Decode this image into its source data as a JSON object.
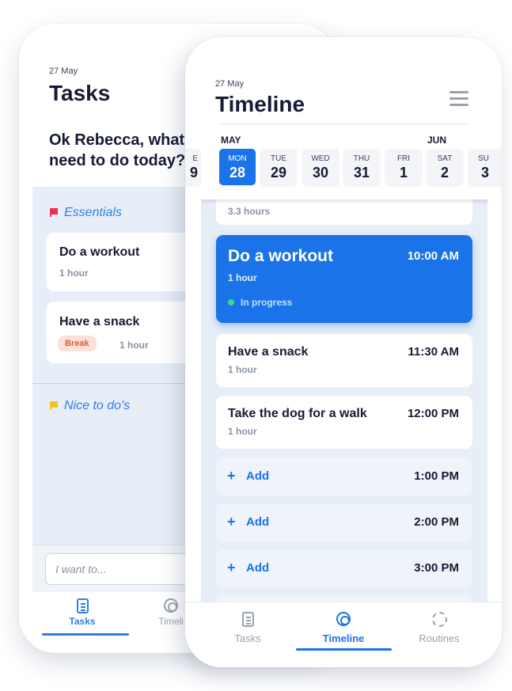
{
  "tasks_screen": {
    "date": "27 May",
    "title": "Tasks",
    "question": "Ok Rebecca, what do you\nneed to do today?",
    "question_visible_line1": "Ok Rebecca, what",
    "question_visible_line2": "need to do today?",
    "sections": [
      {
        "label": "Essentials",
        "flag_color": "#ee2d52",
        "items": [
          {
            "title": "Do a workout",
            "duration": "1 hour"
          },
          {
            "title": "Have a snack",
            "badge": "Break",
            "duration": "1 hour"
          }
        ]
      },
      {
        "label": "Nice to do's",
        "flag_color": "#f4c21c",
        "items": []
      }
    ],
    "input_placeholder": "I want to...",
    "tabs": [
      {
        "label": "Tasks",
        "icon": "tasks-icon",
        "active": true
      },
      {
        "label": "Timeli",
        "icon": "timeline-icon",
        "active": false
      }
    ]
  },
  "timeline_screen": {
    "date": "27 May",
    "title": "Timeline",
    "months": {
      "first": "MAY",
      "second": "JUN"
    },
    "days": [
      {
        "name": "E",
        "num": "9"
      },
      {
        "name": "MON",
        "num": "28",
        "active": true
      },
      {
        "name": "TUE",
        "num": "29"
      },
      {
        "name": "WED",
        "num": "30"
      },
      {
        "name": "THU",
        "num": "31"
      },
      {
        "name": "FRI",
        "num": "1"
      },
      {
        "name": "SAT",
        "num": "2"
      },
      {
        "name": "SU",
        "num": "3"
      }
    ],
    "previous_item_duration": "3.3 hours",
    "entries": [
      {
        "title": "Do a workout",
        "time": "10:00 AM",
        "duration": "1 hour",
        "status": "In progress",
        "active": true
      },
      {
        "title": "Have a snack",
        "time": "11:30 AM",
        "duration": "1 hour"
      },
      {
        "title": "Take the dog for a walk",
        "time": "12:00 PM",
        "duration": "1 hour"
      }
    ],
    "add_slots": [
      {
        "label": "Add",
        "time": "1:00 PM"
      },
      {
        "label": "Add",
        "time": "2:00 PM"
      },
      {
        "label": "Add",
        "time": "3:00 PM"
      }
    ],
    "tabs": [
      {
        "label": "Tasks",
        "icon": "tasks-icon"
      },
      {
        "label": "Timeline",
        "icon": "timeline-icon",
        "active": true
      },
      {
        "label": "Routines",
        "icon": "routines-icon"
      }
    ]
  },
  "colors": {
    "accent": "#1a73e8",
    "list_background": "#e7eef7",
    "in_progress_dot": "#3ddc84",
    "break_badge_bg": "#fde0d9",
    "break_badge_text": "#e0593b"
  }
}
